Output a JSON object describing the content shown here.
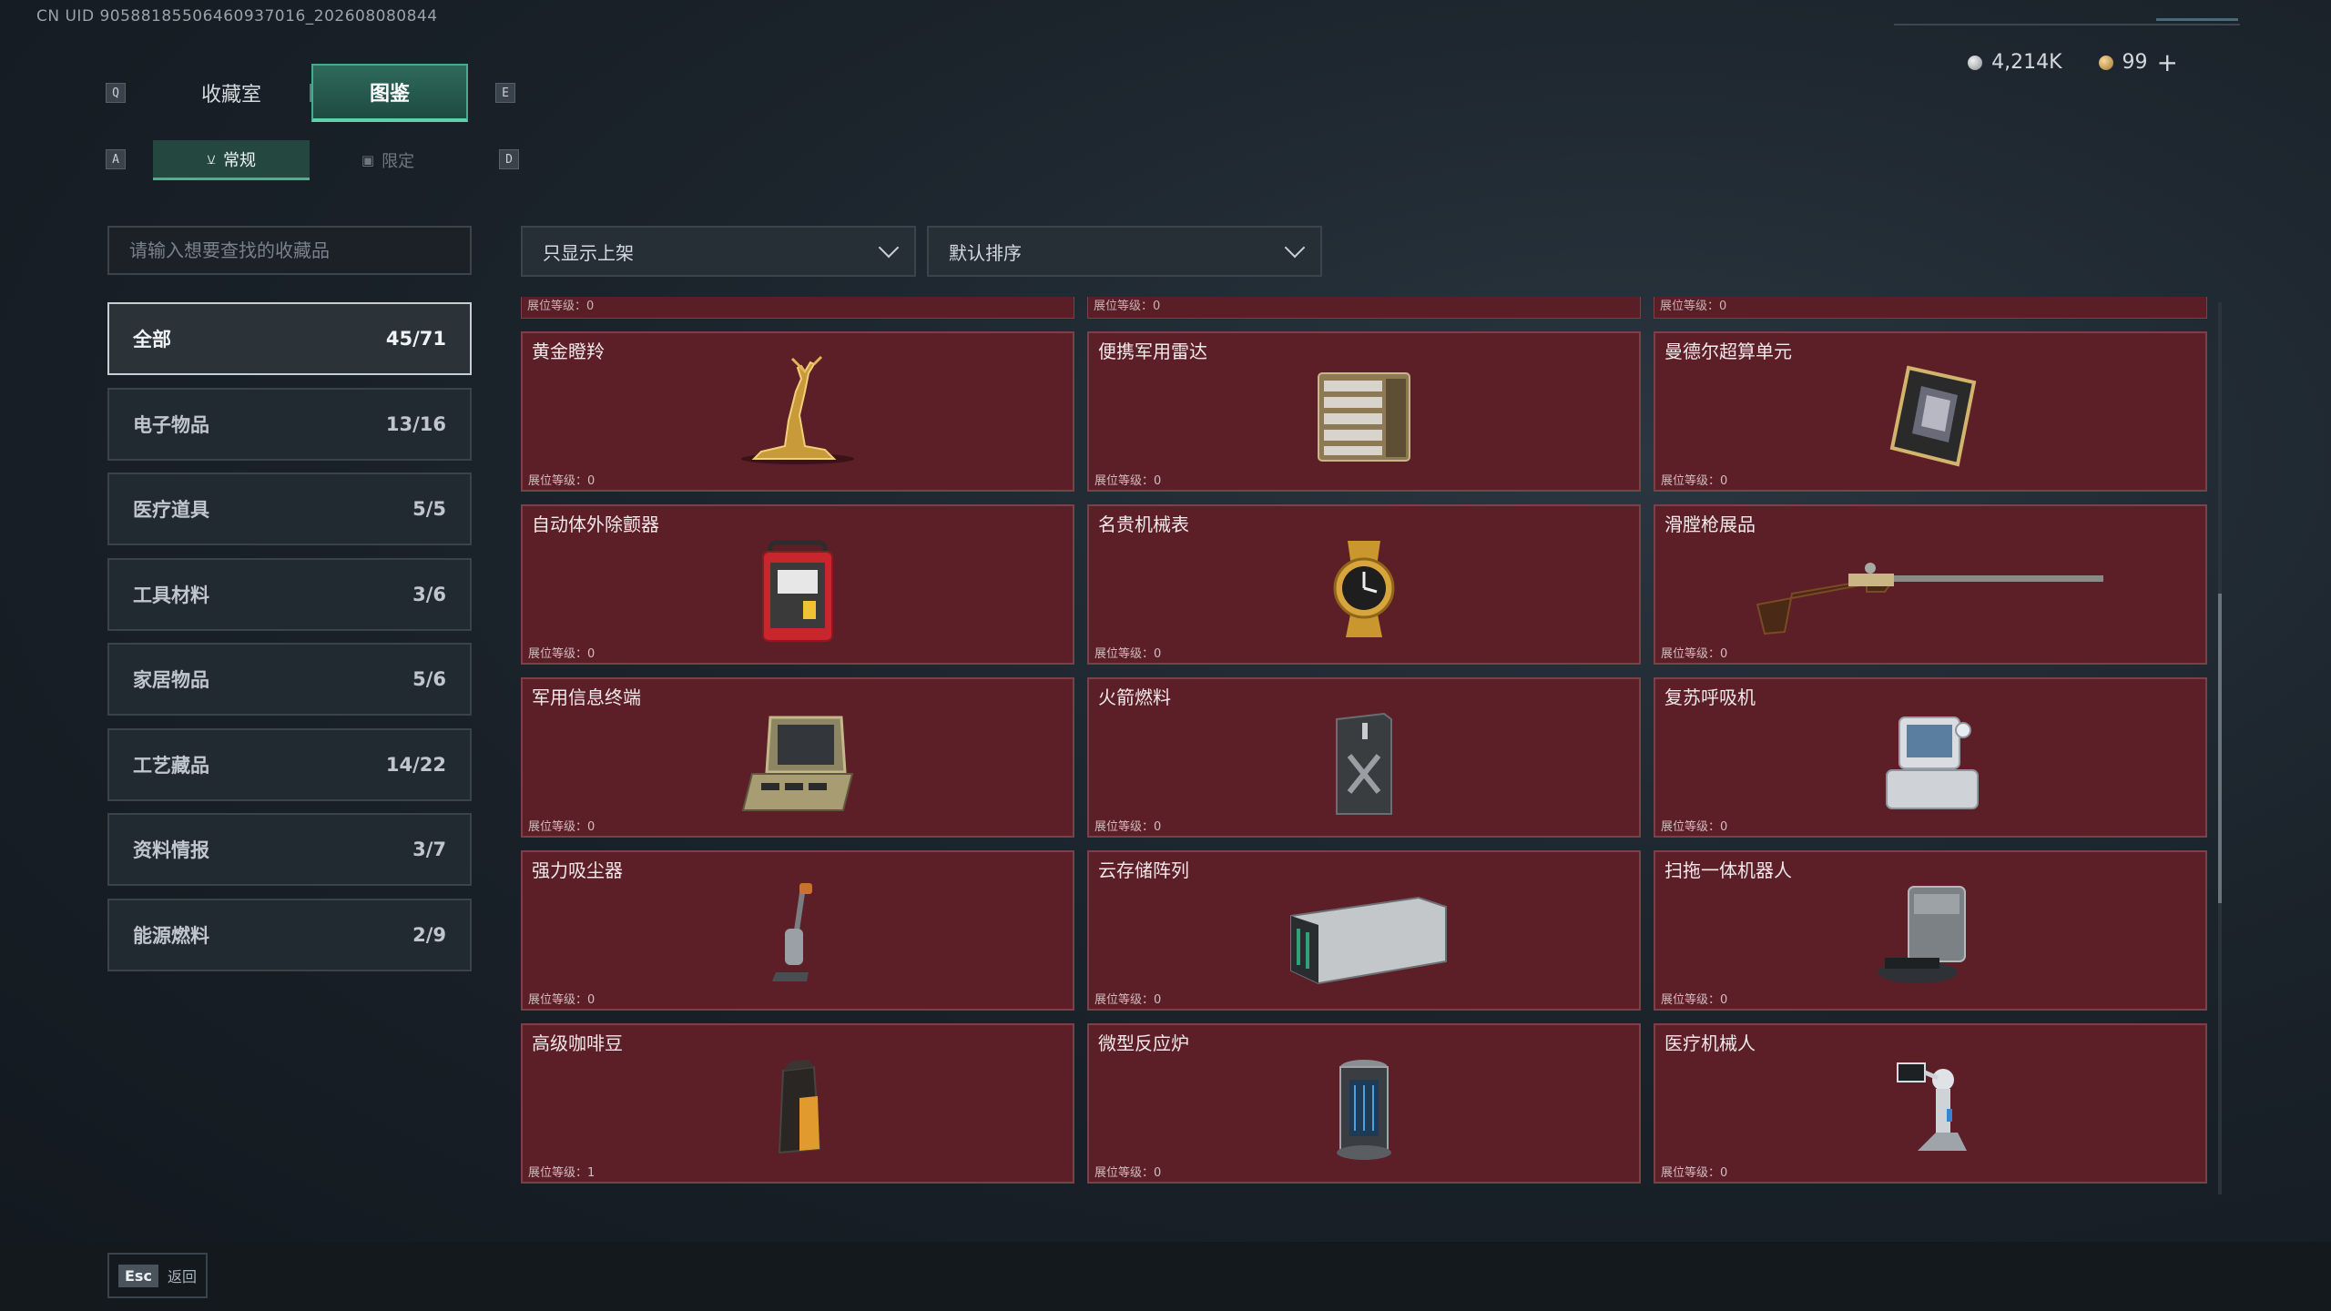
{
  "uid_text": "CN UID 905881855064609370​16_202608080844",
  "currency": {
    "silver": "4,214K",
    "gold": "99",
    "add_label": "+"
  },
  "keys": {
    "prev_tab": "Q",
    "next_tab": "E",
    "prev_sub": "A",
    "next_sub": "D"
  },
  "tabs": [
    {
      "label": "收藏室"
    },
    {
      "label": "图鉴"
    }
  ],
  "subtabs": [
    {
      "label": "常规"
    },
    {
      "label": "限定"
    }
  ],
  "search": {
    "placeholder": "请输入想要查找的收藏品"
  },
  "filters": {
    "display": "只显示上架",
    "sort": "默认排序"
  },
  "categories": [
    {
      "label": "全部",
      "count": "45/71"
    },
    {
      "label": "电子物品",
      "count": "13/16"
    },
    {
      "label": "医疗道具",
      "count": "5/5"
    },
    {
      "label": "工具材料",
      "count": "3/6"
    },
    {
      "label": "家居物品",
      "count": "5/6"
    },
    {
      "label": "工艺藏品",
      "count": "14/22"
    },
    {
      "label": "资料情报",
      "count": "3/7"
    },
    {
      "label": "能源燃料",
      "count": "2/9"
    }
  ],
  "top_stubs": [
    "展位等级：0",
    "展位等级：0",
    "展位等级：0"
  ],
  "items": [
    {
      "name": "黄金瞪羚",
      "level": "展位等级：0",
      "icon": "gold-gazelle-icon"
    },
    {
      "name": "便携军用雷达",
      "level": "展位等级：0",
      "icon": "radar-icon"
    },
    {
      "name": "曼德尔超算单元",
      "level": "展位等级：0",
      "icon": "cpu-icon"
    },
    {
      "name": "自动体外除颤器",
      "level": "展位等级：0",
      "icon": "defibrillator-icon"
    },
    {
      "name": "名贵机械表",
      "level": "展位等级：0",
      "icon": "watch-icon"
    },
    {
      "name": "滑膛枪展品",
      "level": "展位等级：0",
      "icon": "musket-icon"
    },
    {
      "name": "军用信息终端",
      "level": "展位等级：0",
      "icon": "terminal-icon"
    },
    {
      "name": "火箭燃料",
      "level": "展位等级：0",
      "icon": "fuel-can-icon"
    },
    {
      "name": "复苏呼吸机",
      "level": "展位等级：0",
      "icon": "ventilator-icon"
    },
    {
      "name": "强力吸尘器",
      "level": "展位等级：0",
      "icon": "vacuum-icon"
    },
    {
      "name": "云存储阵列",
      "level": "展位等级：0",
      "icon": "storage-array-icon"
    },
    {
      "name": "扫拖一体机器人",
      "level": "展位等级：0",
      "icon": "robot-mop-icon"
    },
    {
      "name": "高级咖啡豆",
      "level": "展位等级：1",
      "icon": "coffee-bag-icon"
    },
    {
      "name": "微型反应炉",
      "level": "展位等级：0",
      "icon": "reactor-icon"
    },
    {
      "name": "医疗机械人",
      "level": "展位等级：0",
      "icon": "medical-robot-icon"
    }
  ],
  "footer": {
    "esc_key": "Esc",
    "back_label": "返回"
  },
  "colors": {
    "accent": "#4fb08f",
    "card_bg": "#5c1f27",
    "card_border": "#7b4148"
  }
}
